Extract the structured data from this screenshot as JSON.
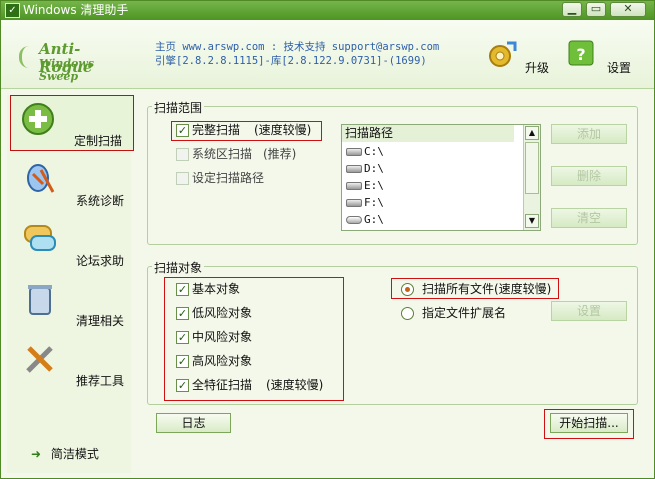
{
  "window": {
    "title": "Windows 清理助手",
    "controls": [
      "minimize",
      "maximize",
      "close"
    ]
  },
  "header": {
    "brand_line1": "Anti-Rogue",
    "brand_line2": "Windows Sweep",
    "info_line1": "主页 www.arswp.com : 技术支持 support@arswp.com",
    "info_line2": "引擎[2.8.2.8.1115]-库[2.8.122.9.0731]-(1699)",
    "upgrade_label": "升级",
    "settings_label": "设置"
  },
  "sidebar": {
    "items": [
      {
        "label": "定制扫描",
        "icon": "plus-circle-icon"
      },
      {
        "label": "系统诊断",
        "icon": "diagnosis-icon"
      },
      {
        "label": "论坛求助",
        "icon": "chat-bubble-icon"
      },
      {
        "label": "清理相关",
        "icon": "recycle-bin-icon"
      },
      {
        "label": "推荐工具",
        "icon": "tools-icon"
      }
    ],
    "simple_mode_label": "简洁模式"
  },
  "scan_range": {
    "title": "扫描范围",
    "options": [
      {
        "label": "完整扫描",
        "note": "(速度较慢)",
        "checked": true,
        "enabled": true
      },
      {
        "label": "系统区扫描",
        "note": "(推荐)",
        "checked": false,
        "enabled": false
      },
      {
        "label": "设定扫描路径",
        "note": "",
        "checked": false,
        "enabled": false
      }
    ],
    "path_list_header": "扫描路径",
    "paths": [
      "C:\\",
      "D:\\",
      "E:\\",
      "F:\\",
      "G:\\"
    ],
    "buttons": {
      "add": "添加",
      "delete": "删除",
      "clear": "清空"
    }
  },
  "scan_objects": {
    "title": "扫描对象",
    "options": [
      {
        "label": "基本对象",
        "note": "",
        "checked": true
      },
      {
        "label": "低风险对象",
        "note": "",
        "checked": true
      },
      {
        "label": "中风险对象",
        "note": "",
        "checked": true
      },
      {
        "label": "高风险对象",
        "note": "",
        "checked": true
      },
      {
        "label": "全特征扫描",
        "note": "(速度较慢)",
        "checked": true
      }
    ],
    "radio_all": "扫描所有文件(速度较慢)",
    "radio_ext": "指定文件扩展名",
    "ext_settings_button": "设置"
  },
  "footer": {
    "log_button": "日志",
    "start_button": "开始扫描..."
  },
  "colors": {
    "accent": "#5d9a2f",
    "highlight_border": "#d01010",
    "info_text": "#2e5fa8"
  }
}
